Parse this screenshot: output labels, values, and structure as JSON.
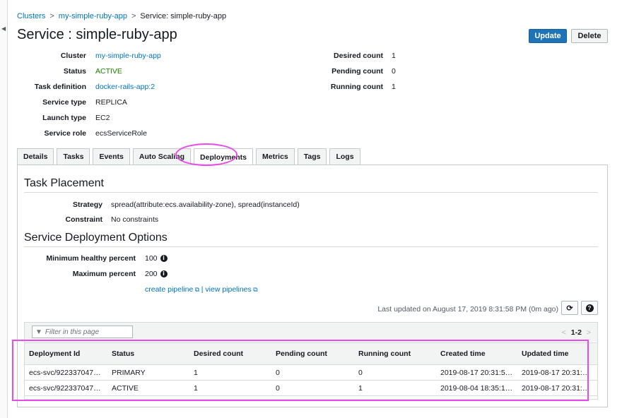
{
  "breadcrumb": {
    "root": "Clusters",
    "cluster": "my-simple-ruby-app",
    "current": "Service: simple-ruby-app",
    "separator": ">"
  },
  "title": "Service : simple-ruby-app",
  "buttons": {
    "update": "Update",
    "delete": "Delete"
  },
  "details_left": [
    {
      "key": "Cluster",
      "value": "my-simple-ruby-app",
      "link": true
    },
    {
      "key": "Status",
      "value": "ACTIVE",
      "color": "#1d8102"
    },
    {
      "key": "Task definition",
      "value": "docker-rails-app:2",
      "link": true
    },
    {
      "key": "Service type",
      "value": "REPLICA"
    },
    {
      "key": "Launch type",
      "value": "EC2"
    },
    {
      "key": "Service role",
      "value": "ecsServiceRole"
    }
  ],
  "details_right": [
    {
      "key": "Desired count",
      "value": "1"
    },
    {
      "key": "Pending count",
      "value": "0"
    },
    {
      "key": "Running count",
      "value": "1"
    }
  ],
  "tabs": [
    "Details",
    "Tasks",
    "Events",
    "Auto Scaling",
    "Deployments",
    "Metrics",
    "Tags",
    "Logs"
  ],
  "active_tab": "Deployments",
  "task_placement": {
    "title": "Task Placement",
    "strategy_label": "Strategy",
    "strategy_value": "spread(attribute:ecs.availability-zone), spread(instanceId)",
    "constraint_label": "Constraint",
    "constraint_value": "No constraints"
  },
  "deployment_options": {
    "title": "Service Deployment Options",
    "min_label": "Minimum healthy percent",
    "min_value": "100",
    "max_label": "Maximum percent",
    "max_value": "200",
    "create_pipeline": "create pipeline",
    "pipe_sep": "|",
    "view_pipelines": "view pipelines"
  },
  "last_updated": "Last updated on August 17, 2019 8:31:58 PM (0m ago)",
  "filter": {
    "placeholder": "Filter in this page"
  },
  "pager": {
    "prev": "<",
    "range": "1-2",
    "next": ">"
  },
  "table": {
    "columns": [
      "Deployment Id",
      "Status",
      "Desired count",
      "Pending count",
      "Running count",
      "Created time",
      "Updated time"
    ],
    "rows": [
      [
        "ecs-svc/9223370470...",
        "PRIMARY",
        "1",
        "0",
        "0",
        "2019-08-17 20:31:52 ...",
        "2019-08-17 20:31:52..."
      ],
      [
        "ecs-svc/9223370471...",
        "ACTIVE",
        "1",
        "0",
        "1",
        "2019-08-04 18:35:14 ...",
        "2019-08-17 20:31:52..."
      ]
    ]
  },
  "icons": {
    "refresh": "refresh-icon",
    "help": "help-icon",
    "filter": "filter-icon",
    "info": "info-icon",
    "external": "external-link-icon"
  },
  "colors": {
    "link": "#0073bb",
    "primary_button": "#1f73b7",
    "active_status": "#1d8102",
    "highlight": "#e94be9"
  }
}
